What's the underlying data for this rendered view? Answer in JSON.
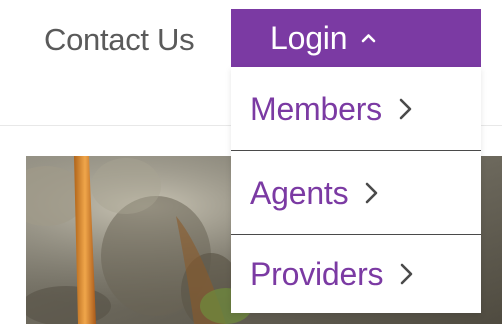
{
  "nav": {
    "contact_label": "Contact Us",
    "login_label": "Login",
    "login_icon": "chevron-up-icon"
  },
  "login_menu": {
    "items": [
      {
        "label": "Members",
        "icon": "chevron-right-icon"
      },
      {
        "label": "Agents",
        "icon": "chevron-right-icon"
      },
      {
        "label": "Providers",
        "icon": "chevron-right-icon"
      }
    ]
  },
  "colors": {
    "accent": "#7b3aa3",
    "nav_text": "#5a5a5a",
    "menu_separator": "#4a4a4a"
  }
}
